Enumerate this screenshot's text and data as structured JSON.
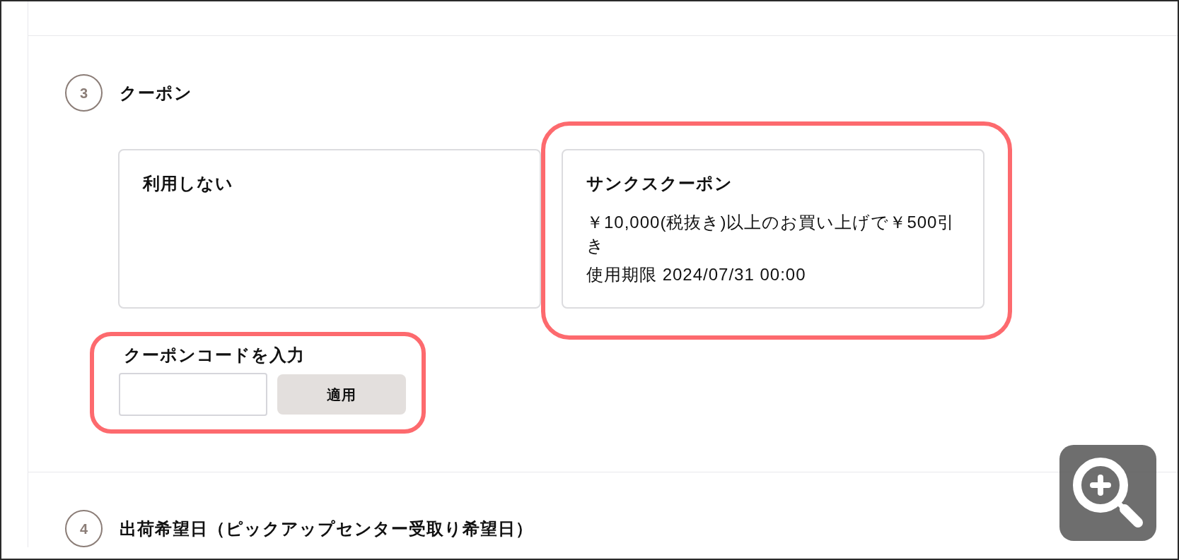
{
  "sections": [
    {
      "number": "3",
      "title": "クーポン",
      "coupon_options": [
        {
          "title": "利用しない",
          "highlighted": false
        },
        {
          "title": "サンクスクーポン",
          "description": "￥10,000(税抜き)以上のお買い上げで￥500引き",
          "expiry": "使用期限 2024/07/31 00:00",
          "highlighted": true
        }
      ],
      "coupon_code": {
        "label": "クーポンコードを入力",
        "apply_button": "適用",
        "highlighted": true
      }
    },
    {
      "number": "4",
      "title": "出荷希望日（ピックアップセンター受取り希望日）"
    }
  ]
}
